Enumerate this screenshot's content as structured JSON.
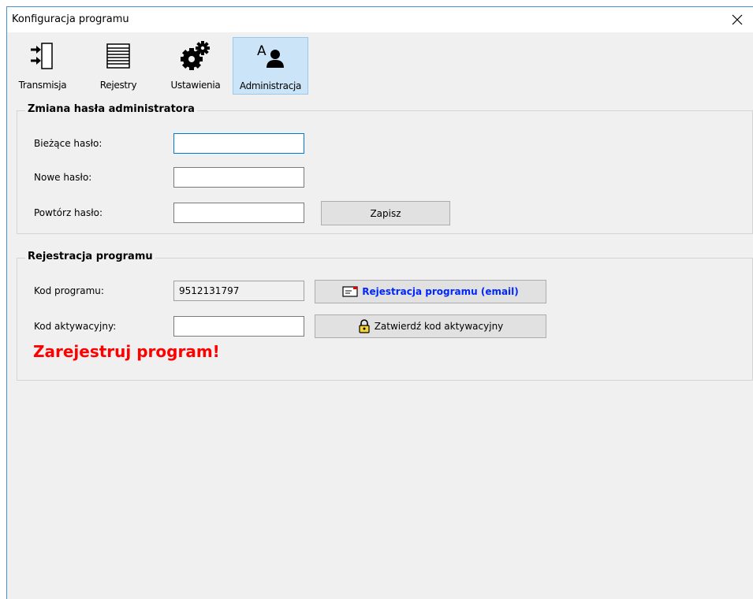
{
  "window": {
    "title": "Konfiguracja programu",
    "close_glyph": "✕"
  },
  "toolbar": {
    "items": [
      {
        "label": "Transmisja",
        "icon": "transfer-icon"
      },
      {
        "label": "Rejestry",
        "icon": "list-icon"
      },
      {
        "label": "Ustawienia",
        "icon": "gears-icon"
      },
      {
        "label": "Administracja",
        "icon": "admin-user-icon",
        "active": true
      }
    ]
  },
  "password_group": {
    "title": "Zmiana hasła administratora",
    "current_label": "Bieżące hasło:",
    "new_label": "Nowe hasło:",
    "repeat_label": "Powtórz hasło:",
    "save_label": "Zapisz"
  },
  "registration_group": {
    "title": "Rejestracja programu",
    "code_label": "Kod programu:",
    "code_value": "9512131797",
    "email_button_label": "Rejestracja programu (email)",
    "activation_label": "Kod aktywacyjny:",
    "confirm_button_label": "Zatwierdź kod aktywacyjny",
    "warning": "Zarejestruj program!"
  },
  "colors": {
    "accent": "#0078d7",
    "warning": "#ff0000",
    "email_link": "#0026ff"
  }
}
